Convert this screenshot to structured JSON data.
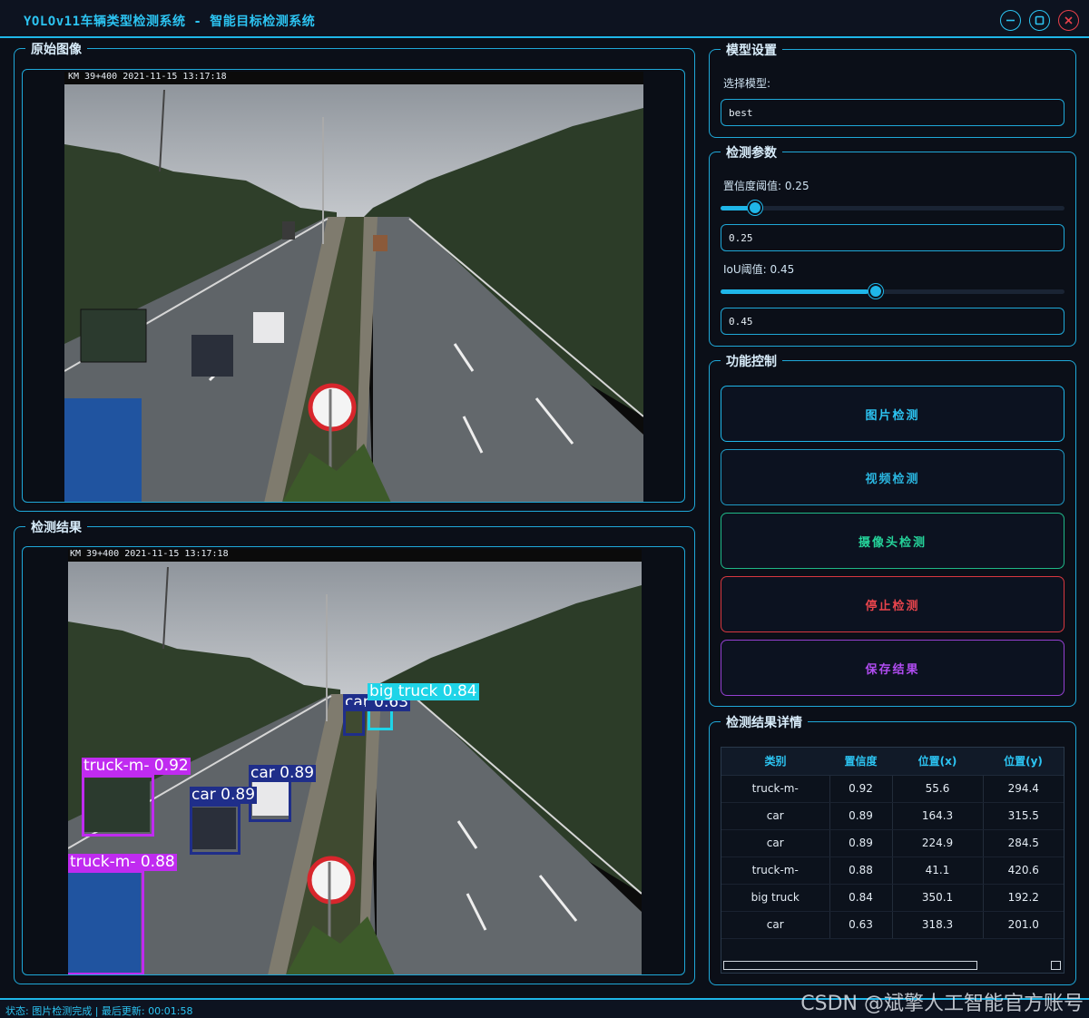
{
  "window": {
    "title": "YOLOv11车辆类型检测系统 - 智能目标检测系统",
    "min_icon": "minimize-icon",
    "max_icon": "maximize-icon",
    "close_icon": "close-icon"
  },
  "original": {
    "title": "原始图像",
    "timestamp": "KM 39+400 2021-11-15 13:17:18"
  },
  "result": {
    "title": "检测结果",
    "timestamp": "KM 39+400 2021-11-15 13:17:18",
    "detections": [
      {
        "label": "truck-m- 0.92",
        "color": "#c02bf0"
      },
      {
        "label": "car 0.89",
        "color": "#1f2e8a"
      },
      {
        "label": "car 0.89",
        "color": "#1f2e8a"
      },
      {
        "label": "truck-m- 0.88",
        "color": "#c02bf0"
      },
      {
        "label": "big truck 0.84",
        "color": "#1fd4e8"
      },
      {
        "label": "car 0.63",
        "color": "#1f2e8a"
      }
    ]
  },
  "model": {
    "title": "模型设置",
    "select_label": "选择模型:",
    "selected": "best"
  },
  "params": {
    "title": "检测参数",
    "conf_label": "置信度阈值: 0.25",
    "conf_value": "0.25",
    "conf_fraction": 0.25,
    "iou_label": "IoU阈值: 0.45",
    "iou_value": "0.45",
    "iou_fraction": 0.45
  },
  "controls": {
    "title": "功能控制",
    "image_detect": "图片检测",
    "video_detect": "视频检测",
    "camera_detect": "摄像头检测",
    "stop_detect": "停止检测",
    "save_results": "保存结果"
  },
  "details": {
    "title": "检测结果详情",
    "columns": [
      "类别",
      "置信度",
      "位置(x)",
      "位置(y)"
    ],
    "rows": [
      [
        "truck-m-",
        "0.92",
        "55.6",
        "294.4"
      ],
      [
        "car",
        "0.89",
        "164.3",
        "315.5"
      ],
      [
        "car",
        "0.89",
        "224.9",
        "284.5"
      ],
      [
        "truck-m-",
        "0.88",
        "41.1",
        "420.6"
      ],
      [
        "big truck",
        "0.84",
        "350.1",
        "192.2"
      ],
      [
        "car",
        "0.63",
        "318.3",
        "201.0"
      ]
    ]
  },
  "status": {
    "text": "状态: 图片检测完成 | 最后更新: 00:01:58"
  },
  "watermark": "CSDN @斌擎人工智能官方账号",
  "colors": {
    "accent": "#1fb6e8",
    "video": "#2ab6e0",
    "camera": "#25d39a",
    "stop": "#e8444c",
    "save": "#b04cf0"
  }
}
